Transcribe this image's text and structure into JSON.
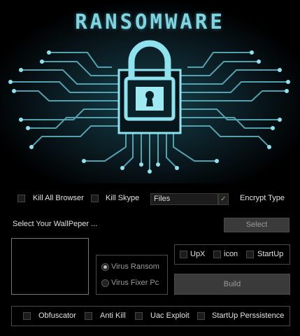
{
  "banner": {
    "title": "RANSOMWARE"
  },
  "options_row1": {
    "kill_all_browser": {
      "label": "Kill All Browser",
      "checked": false
    },
    "kill_skype": {
      "label": "Kill Skype",
      "checked": false
    },
    "encrypt_type": {
      "selected": "Files",
      "label": "Encrypt Type"
    }
  },
  "wallpaper": {
    "label": "Select Your WallPeper ...",
    "select_button": "Select"
  },
  "mode": {
    "options": [
      {
        "label": "Virus Ransom",
        "selected": true
      },
      {
        "label": "Virus Fixer Pc",
        "selected": false
      }
    ]
  },
  "build_options": {
    "upx": {
      "label": "UpX",
      "checked": false
    },
    "icon": {
      "label": "icon",
      "checked": false
    },
    "startup": {
      "label": "StartUp",
      "checked": false
    },
    "build_button": "Build"
  },
  "bottom_options": {
    "obfuscator": {
      "label": "Obfuscator",
      "checked": false
    },
    "anti_kill": {
      "label": "Anti Kill",
      "checked": false
    },
    "uac_exploit": {
      "label": "Uac Exploit",
      "checked": false
    },
    "startup_persistence": {
      "label": "StartUp Perssistence",
      "checked": false
    }
  },
  "colors": {
    "accent": "#7fd6e2",
    "background": "#000000",
    "check_mark": "#58c558"
  },
  "icons": {
    "lock": "padlock-icon",
    "circuit": "circuit-board-graphic"
  }
}
